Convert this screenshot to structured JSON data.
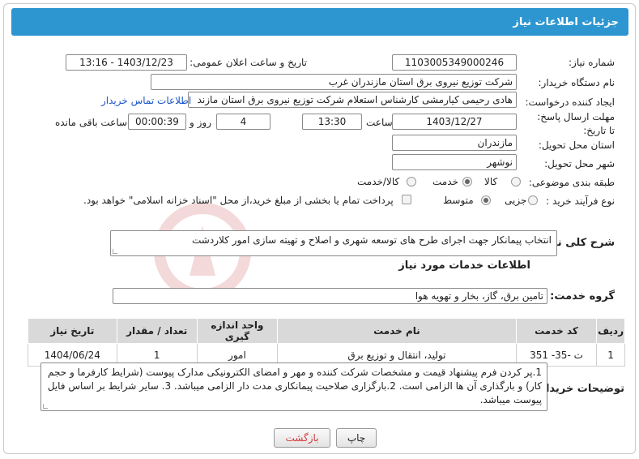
{
  "header": {
    "title": "جزئیات اطلاعات نیاز"
  },
  "labels": {
    "need_number": "شماره نیاز:",
    "announce_datetime": "تاریخ و ساعت اعلان عمومی:",
    "buyer_org": "نام دستگاه خریدار:",
    "requester": "ایجاد کننده درخواست:",
    "deadline": "مهلت ارسال پاسخ: تا تاریخ:",
    "time_word": "ساعت",
    "day_and": "روز و",
    "remaining": "ساعت باقی مانده",
    "province": "استان محل تحویل:",
    "city": "شهر محل تحویل:",
    "category": "طبقه بندی موضوعی:",
    "process": "نوع فرآیند خرید :",
    "general_desc": "شرح کلی نیاز:",
    "services_info": "اطلاعات خدمات مورد نیاز",
    "service_group": "گروه خدمت:",
    "buyer_notes": "توضیحات خریدار:"
  },
  "values": {
    "need_number": "1103005349000246",
    "announce_datetime": "1403/12/23 - 13:16",
    "buyer_org": "شرکت توزیع نیروی برق استان مازندران غرب",
    "requester": "هادی رحیمی کیارمشی کارشناس استعلام شرکت توزیع نیروی برق استان مازند",
    "deadline_date": "1403/12/27",
    "deadline_time": "13:30",
    "days": "4",
    "remaining_time": "00:00:39",
    "province": "مازندران",
    "city": "نوشهر",
    "general_desc": "انتخاب پیمانکار جهت اجرای طرح های توسعه شهری و اصلاح و تهیته سازی امور کلاردشت",
    "service_group": "تامین برق، گاز، بخار و تهویه هوا",
    "buyer_notes": "1.پر کردن فرم پیشنهاد قیمت و مشخصات شرکت کننده و مهر و امضای الکترونیکی مدارک پیوست (شرایط کارفرما و حجم کار) و بارگذاری آن ها الزامی است. 2.بارگزاری صلاحیت پیمانکاری مدت دار الزامی میباشد. 3. سایر شرایط بر اساس فایل پیوست میباشد."
  },
  "contact_link": "اطلاعات تماس خریدار",
  "category_options": {
    "goods": "کالا",
    "service": "خدمت",
    "goods_service": "کالا/خدمت",
    "selected": "خدمت"
  },
  "process_options": {
    "partial": "جزیی",
    "medium": "متوسط",
    "selected": "متوسط",
    "payment_note": "پرداخت تمام یا بخشی از مبلغ خرید،از محل \"اسناد خزانه اسلامی\" خواهد بود."
  },
  "table": {
    "headers": [
      "ردیف",
      "کد خدمت",
      "نام خدمت",
      "واحد اندازه گیری",
      "تعداد / مقدار",
      "تاریخ نیاز"
    ],
    "rows": [
      [
        "1",
        "ت -35- 351",
        "تولید، انتقال و توزیع برق",
        "امور",
        "1",
        "1404/06/24"
      ]
    ]
  },
  "buttons": {
    "print": "چاپ",
    "back": "بازگشت"
  },
  "watermark": "AriaTender.neT",
  "colors": {
    "header_bg": "#2d96d0",
    "link": "#1a55c9",
    "back_button_text": "#d23c3c"
  }
}
